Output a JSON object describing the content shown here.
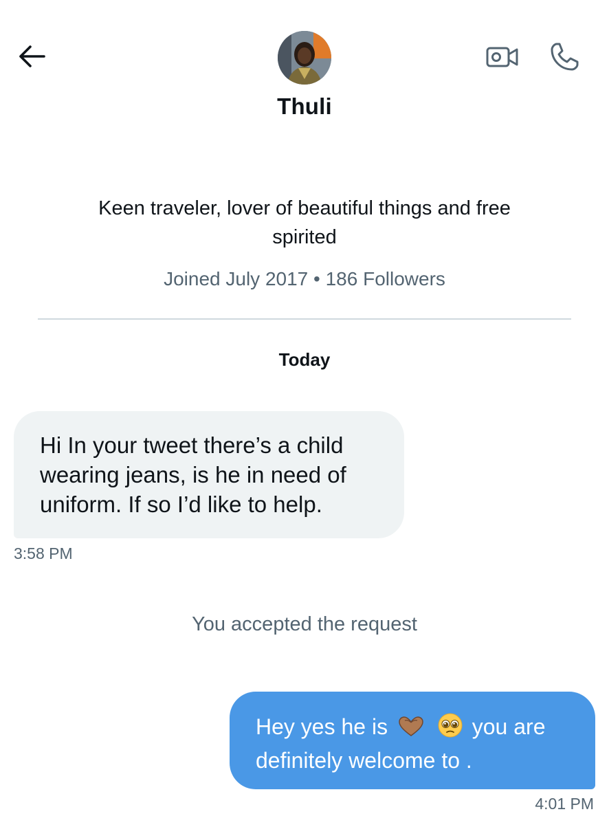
{
  "header": {
    "back_icon": "arrow-left-icon",
    "video_icon": "video-camera-icon",
    "phone_icon": "phone-icon"
  },
  "profile": {
    "name": "Thuli",
    "bio": "Keen traveler, lover of beautiful things and free spirited",
    "joined": "Joined July 2017",
    "separator": "•",
    "followers": "186 Followers"
  },
  "conversation": {
    "day_label": "Today",
    "messages": [
      {
        "direction": "incoming",
        "text": "Hi In your tweet there’s a child wearing jeans, is he in need of uniform. If so I’d like to help.",
        "time": "3:58 PM"
      },
      {
        "direction": "outgoing",
        "text_part1": "Hey yes he is",
        "emojis": [
          "heart-hands-emoji",
          "pleading-face-emoji"
        ],
        "text_part2": "you are definitely welcome to .",
        "time": "4:01 PM"
      }
    ],
    "system_note": "You accepted the request"
  },
  "colors": {
    "outgoing_bubble": "#4a98e6",
    "incoming_bubble": "#eff3f4",
    "secondary_text": "#536471",
    "divider": "#cfd9de"
  }
}
